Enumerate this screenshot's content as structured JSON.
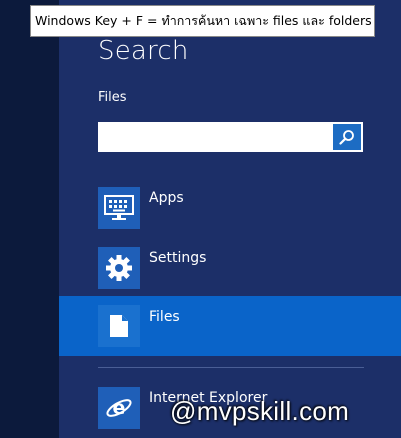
{
  "tooltip": {
    "text": "Windows Key + F = ทำการค้นหา เฉพาะ files และ folders"
  },
  "search": {
    "title": "Search",
    "scope_label": "Files",
    "input_value": "",
    "button_icon": "magnifier-icon"
  },
  "results": [
    {
      "label": "Apps",
      "icon": "keyboard-icon",
      "selected": false
    },
    {
      "label": "Settings",
      "icon": "gear-icon",
      "selected": false
    },
    {
      "label": "Files",
      "icon": "document-icon",
      "selected": true
    }
  ],
  "apps": [
    {
      "label": "Internet Explorer",
      "icon": "internet-explorer-icon"
    }
  ],
  "watermark": "@mvpskill.com",
  "colors": {
    "panel_bg": "#1c2f68",
    "selected_bg": "#0a64c9",
    "tile_bg": "#1f5fb8",
    "search_button": "#1d6cc3"
  }
}
